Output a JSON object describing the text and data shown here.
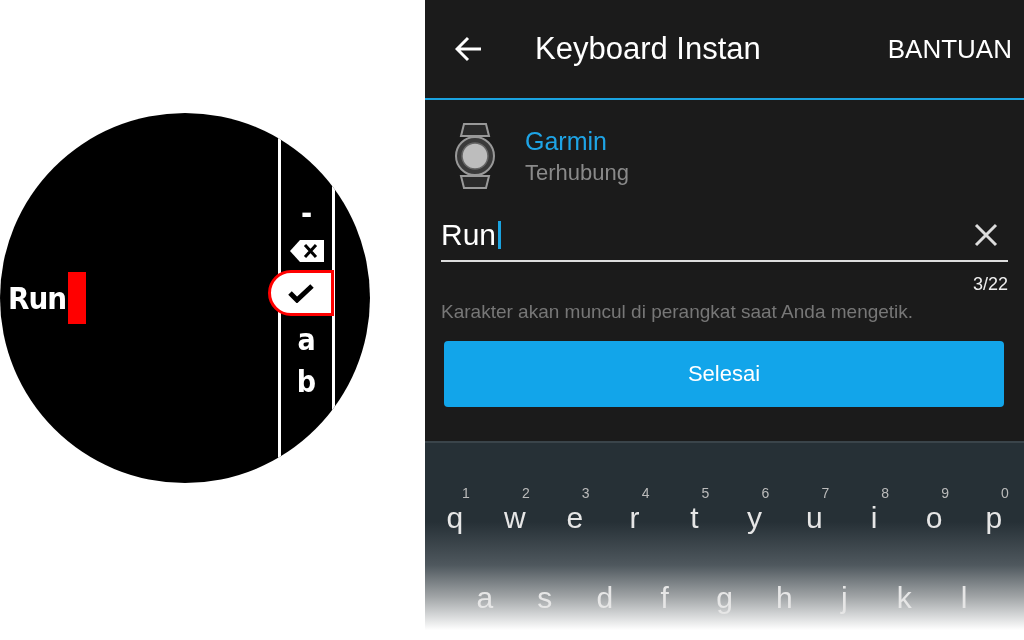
{
  "watch": {
    "input_text": "Run",
    "picker": [
      {
        "kind": "char",
        "label": "-",
        "selected": false
      },
      {
        "kind": "backspace",
        "selected": false
      },
      {
        "kind": "confirm",
        "selected": true
      },
      {
        "kind": "char",
        "label": "a",
        "selected": false
      },
      {
        "kind": "char",
        "label": "b",
        "selected": false
      }
    ]
  },
  "phone": {
    "header": {
      "title": "Keyboard Instan",
      "action": "BANTUAN"
    },
    "device": {
      "name": "Garmin",
      "status": "Terhubung"
    },
    "input": {
      "value": "Run",
      "counter": "3/22"
    },
    "hint": "Karakter akan muncul di perangkat saat Anda mengetik.",
    "button": "Selesai",
    "keyboard": [
      {
        "keys": [
          {
            "letter": "q",
            "hint": "1"
          },
          {
            "letter": "w",
            "hint": "2"
          },
          {
            "letter": "e",
            "hint": "3"
          },
          {
            "letter": "r",
            "hint": "4"
          },
          {
            "letter": "t",
            "hint": "5"
          },
          {
            "letter": "y",
            "hint": "6"
          },
          {
            "letter": "u",
            "hint": "7"
          },
          {
            "letter": "i",
            "hint": "8"
          },
          {
            "letter": "o",
            "hint": "9"
          },
          {
            "letter": "p",
            "hint": "0"
          }
        ]
      },
      {
        "keys": [
          {
            "letter": "a"
          },
          {
            "letter": "s"
          },
          {
            "letter": "d"
          },
          {
            "letter": "f"
          },
          {
            "letter": "g"
          },
          {
            "letter": "h"
          },
          {
            "letter": "j"
          },
          {
            "letter": "k"
          },
          {
            "letter": "l"
          }
        ]
      }
    ]
  }
}
